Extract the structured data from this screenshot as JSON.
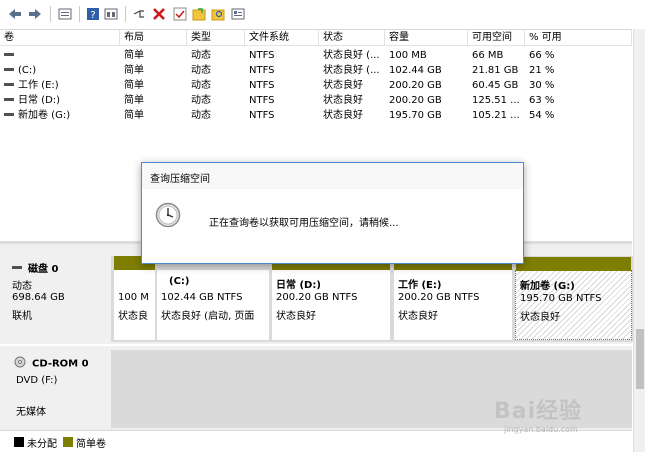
{
  "toolbar": {
    "buttons": [
      "back-icon",
      "forward-icon",
      "show-list-icon",
      "help-icon",
      "properties-icon",
      "connect-icon",
      "delete-icon",
      "check-icon",
      "folder-icon",
      "search-folder-icon",
      "settings-icon"
    ]
  },
  "volume_list": {
    "columns": [
      "卷",
      "布局",
      "类型",
      "文件系统",
      "状态",
      "容量",
      "可用空间",
      "% 可用"
    ],
    "rows": [
      {
        "volume": "",
        "layout": "简单",
        "type": "动态",
        "fs": "NTFS",
        "status": "状态良好 (...",
        "capacity": "100 MB",
        "free": "66 MB",
        "pct": "66 %"
      },
      {
        "volume": "(C:)",
        "layout": "简单",
        "type": "动态",
        "fs": "NTFS",
        "status": "状态良好 (...",
        "capacity": "102.44 GB",
        "free": "21.81 GB",
        "pct": "21 %"
      },
      {
        "volume": "工作 (E:)",
        "layout": "简单",
        "type": "动态",
        "fs": "NTFS",
        "status": "状态良好",
        "capacity": "200.20 GB",
        "free": "60.45 GB",
        "pct": "30 %"
      },
      {
        "volume": "日常 (D:)",
        "layout": "简单",
        "type": "动态",
        "fs": "NTFS",
        "status": "状态良好",
        "capacity": "200.20 GB",
        "free": "125.51 ...",
        "pct": "63 %"
      },
      {
        "volume": "新加卷 (G:)",
        "layout": "简单",
        "type": "动态",
        "fs": "NTFS",
        "status": "状态良好",
        "capacity": "195.70 GB",
        "free": "105.21 ...",
        "pct": "54 %"
      }
    ]
  },
  "disk0": {
    "name": "磁盘 0",
    "type": "动态",
    "size": "698.64 GB",
    "state": "联机",
    "partitions": [
      {
        "label": "",
        "line2": "100 M",
        "line3": "状态良"
      },
      {
        "label": "(C:)",
        "line2": "102.44 GB NTFS",
        "line3": "状态良好 (启动, 页面"
      },
      {
        "label": "日常  (D:)",
        "line2": "200.20 GB NTFS",
        "line3": "状态良好"
      },
      {
        "label": "工作  (E:)",
        "line2": "200.20 GB NTFS",
        "line3": "状态良好"
      },
      {
        "label": "新加卷  (G:)",
        "line2": "195.70 GB NTFS",
        "line3": "状态良好"
      }
    ]
  },
  "cdrom": {
    "name": "CD-ROM 0",
    "drive": "DVD (F:)",
    "media": "无媒体"
  },
  "legend": {
    "unallocated": "未分配",
    "simple": "简单卷",
    "unallocated_color": "#000000",
    "simple_color": "#7e7e00"
  },
  "dialog": {
    "title": "查询压缩空间",
    "message": "正在查询卷以获取可用压缩空间，请稍候..."
  },
  "watermark": {
    "text": "Bai经验",
    "sub": "jingyan.baidu.com"
  }
}
